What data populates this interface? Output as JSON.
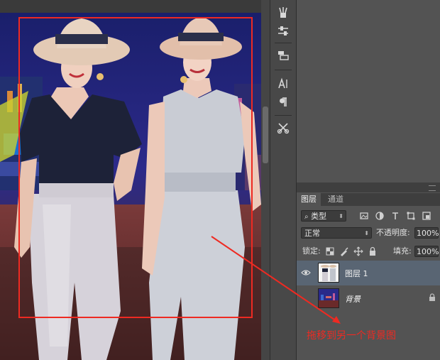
{
  "canvas": {
    "image_description": "two women in sun hats walking"
  },
  "toolstrip": {
    "tools": [
      "brush-presets-icon",
      "adjust-sliders-icon",
      "layer-comps-icon",
      "character-icon",
      "paragraph-icon",
      "tool-presets-icon"
    ]
  },
  "layers_panel": {
    "tabs": [
      "图层",
      "通道"
    ],
    "filter_kind": "类型",
    "blend_mode": "正常",
    "opacity_label": "不透明度:",
    "opacity_value": "100%",
    "lock_label": "锁定:",
    "fill_label": "填充:",
    "fill_value": "100%",
    "layers": [
      {
        "name": "图层 1",
        "selected": true,
        "visible": true
      },
      {
        "name": "背景",
        "selected": false,
        "visible": false,
        "locked": true
      }
    ]
  },
  "annotation": {
    "text": "拖移到另一个背景图",
    "color": "#ee2a22"
  },
  "colors": {
    "panel_bg": "#535353",
    "selected_layer": "#596573",
    "annotation_red": "#ee2a22"
  }
}
